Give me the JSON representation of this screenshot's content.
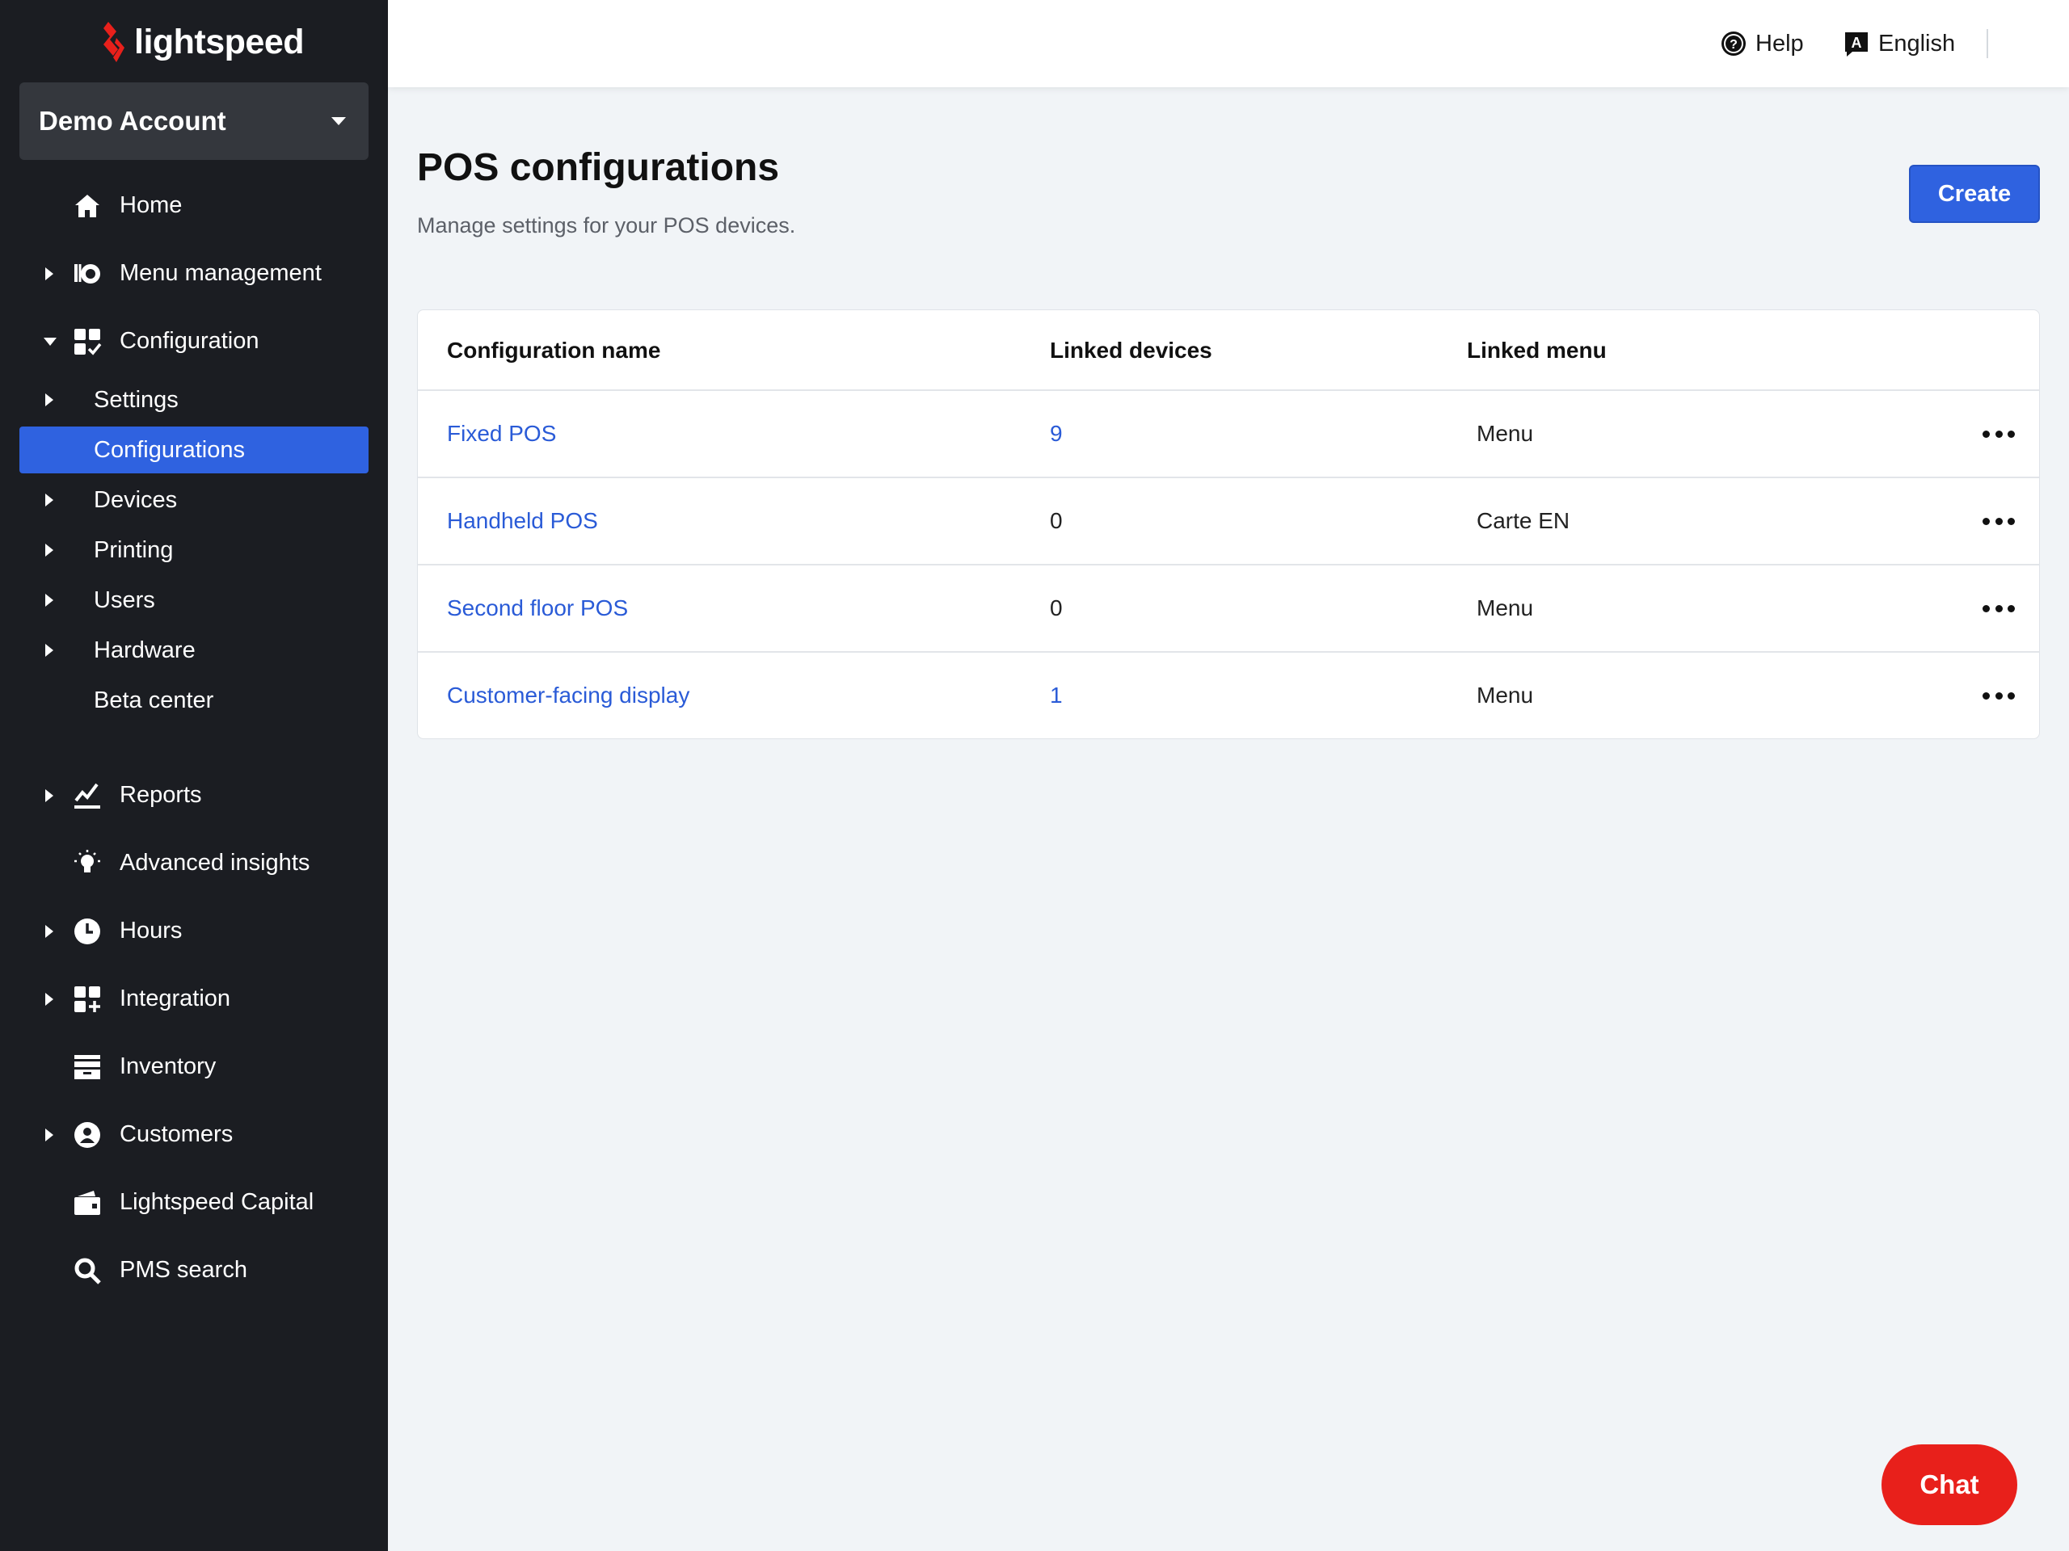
{
  "brand": {
    "name": "lightspeed"
  },
  "colors": {
    "accent": "#2f62e0",
    "sidebar": "#1b1d22",
    "chat": "#e8201b",
    "link": "#2a5bd7"
  },
  "account": {
    "name": "Demo Account"
  },
  "sidebar": {
    "home": "Home",
    "menu_management": "Menu management",
    "configuration": "Configuration",
    "sub": {
      "settings": "Settings",
      "configurations": "Configurations",
      "devices": "Devices",
      "printing": "Printing",
      "users": "Users",
      "hardware": "Hardware",
      "beta_center": "Beta center"
    },
    "reports": "Reports",
    "advanced_insights": "Advanced insights",
    "hours": "Hours",
    "integration": "Integration",
    "inventory": "Inventory",
    "customers": "Customers",
    "lightspeed_capital": "Lightspeed Capital",
    "pms_search": "PMS search"
  },
  "topbar": {
    "help": "Help",
    "language": "English"
  },
  "page": {
    "title": "POS configurations",
    "subtitle": "Manage settings for your POS devices.",
    "create_label": "Create"
  },
  "table": {
    "headers": {
      "name": "Configuration name",
      "devices": "Linked devices",
      "menu": "Linked menu"
    },
    "rows": [
      {
        "name": "Fixed POS",
        "devices": "9",
        "menu": "Menu"
      },
      {
        "name": "Handheld POS",
        "devices": "0",
        "menu": "Carte EN"
      },
      {
        "name": "Second floor POS",
        "devices": "0",
        "menu": "Menu"
      },
      {
        "name": "Customer-facing display",
        "devices": "1",
        "menu": "Menu"
      }
    ]
  },
  "chat": {
    "label": "Chat"
  }
}
